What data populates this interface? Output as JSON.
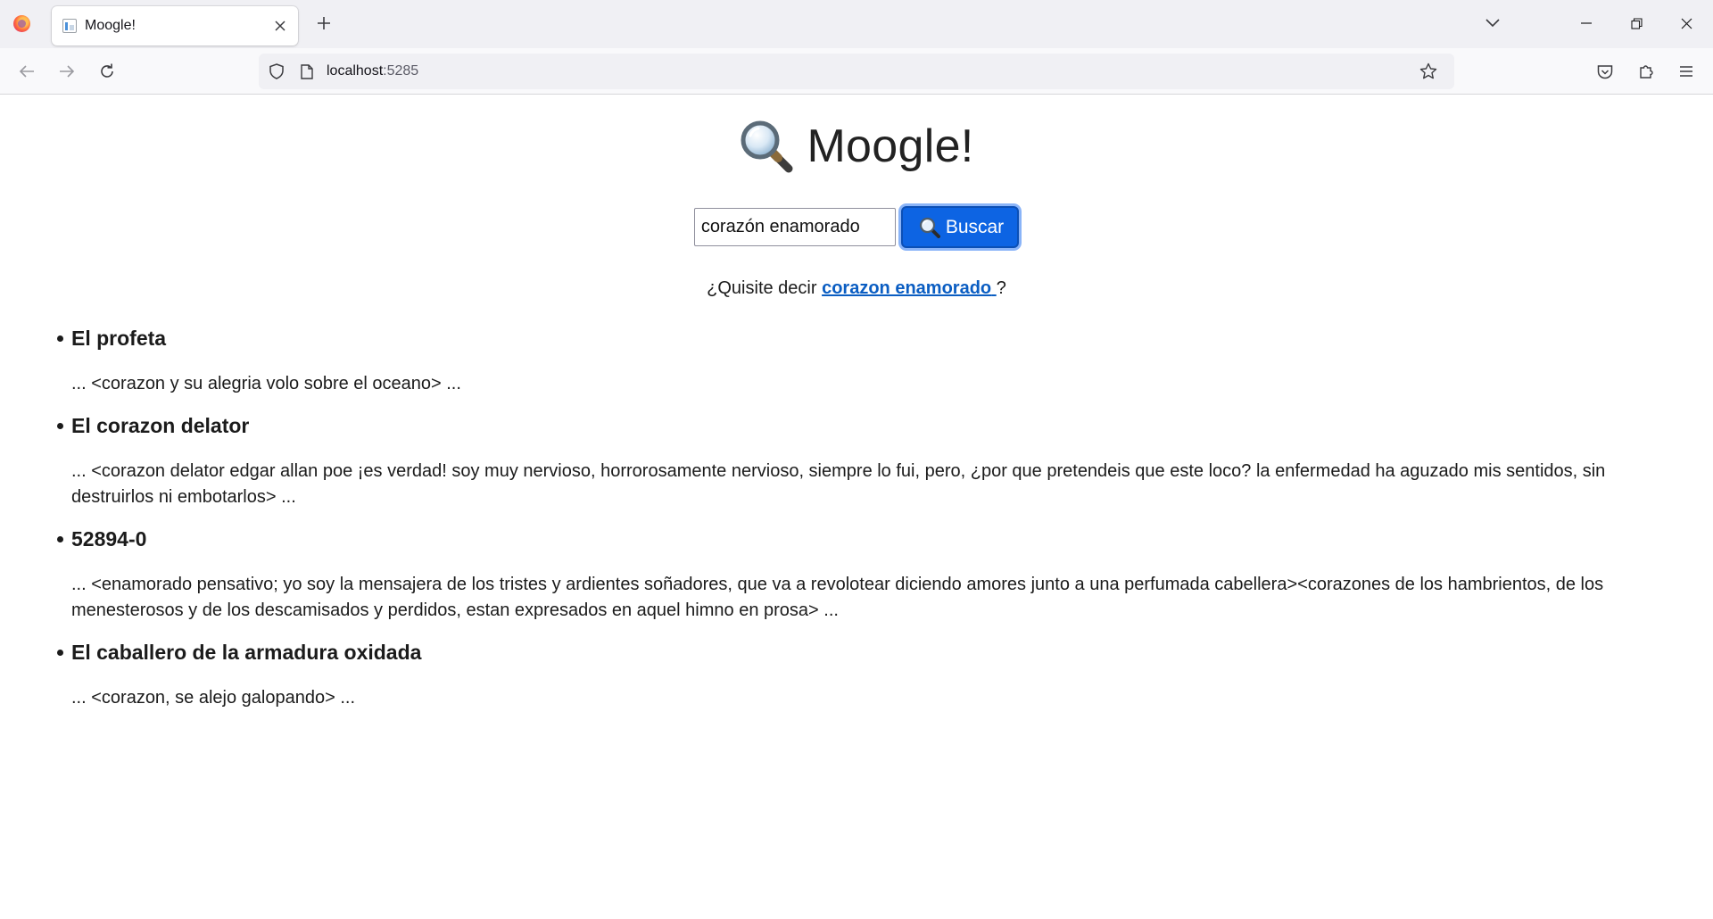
{
  "browser": {
    "tab_title": "Moogle!",
    "url_host": "localhost",
    "url_port": ":5285"
  },
  "page": {
    "title": "Moogle!",
    "search": {
      "value": "corazón enamorado",
      "button_label": "Buscar"
    },
    "suggestion": {
      "prefix": "¿Quisite decir",
      "link": "corazon enamorado",
      "suffix": "?"
    },
    "results": [
      {
        "title": "El profeta",
        "snippet": "... <corazon y su alegria volo sobre el oceano> ..."
      },
      {
        "title": "El corazon delator",
        "snippet": "... <corazon delator edgar allan poe ¡es verdad! soy muy nervioso, horrorosamente nervioso, siempre lo fui, pero, ¿por que pretendeis que este loco? la enfermedad ha aguzado mis sentidos, sin destruirlos ni embotarlos> ..."
      },
      {
        "title": "52894-0",
        "snippet": "... <enamorado pensativo; yo soy la mensajera de los tristes y ardientes soñadores, que va a revolotear diciendo amores junto a una perfumada cabellera><corazones de los hambrientos, de los menesterosos y de los descamisados y perdidos, estan expresados en aquel himno en prosa> ..."
      },
      {
        "title": "El caballero de la armadura oxidada",
        "snippet": "... <corazon, se alejo galopando> ..."
      }
    ]
  }
}
